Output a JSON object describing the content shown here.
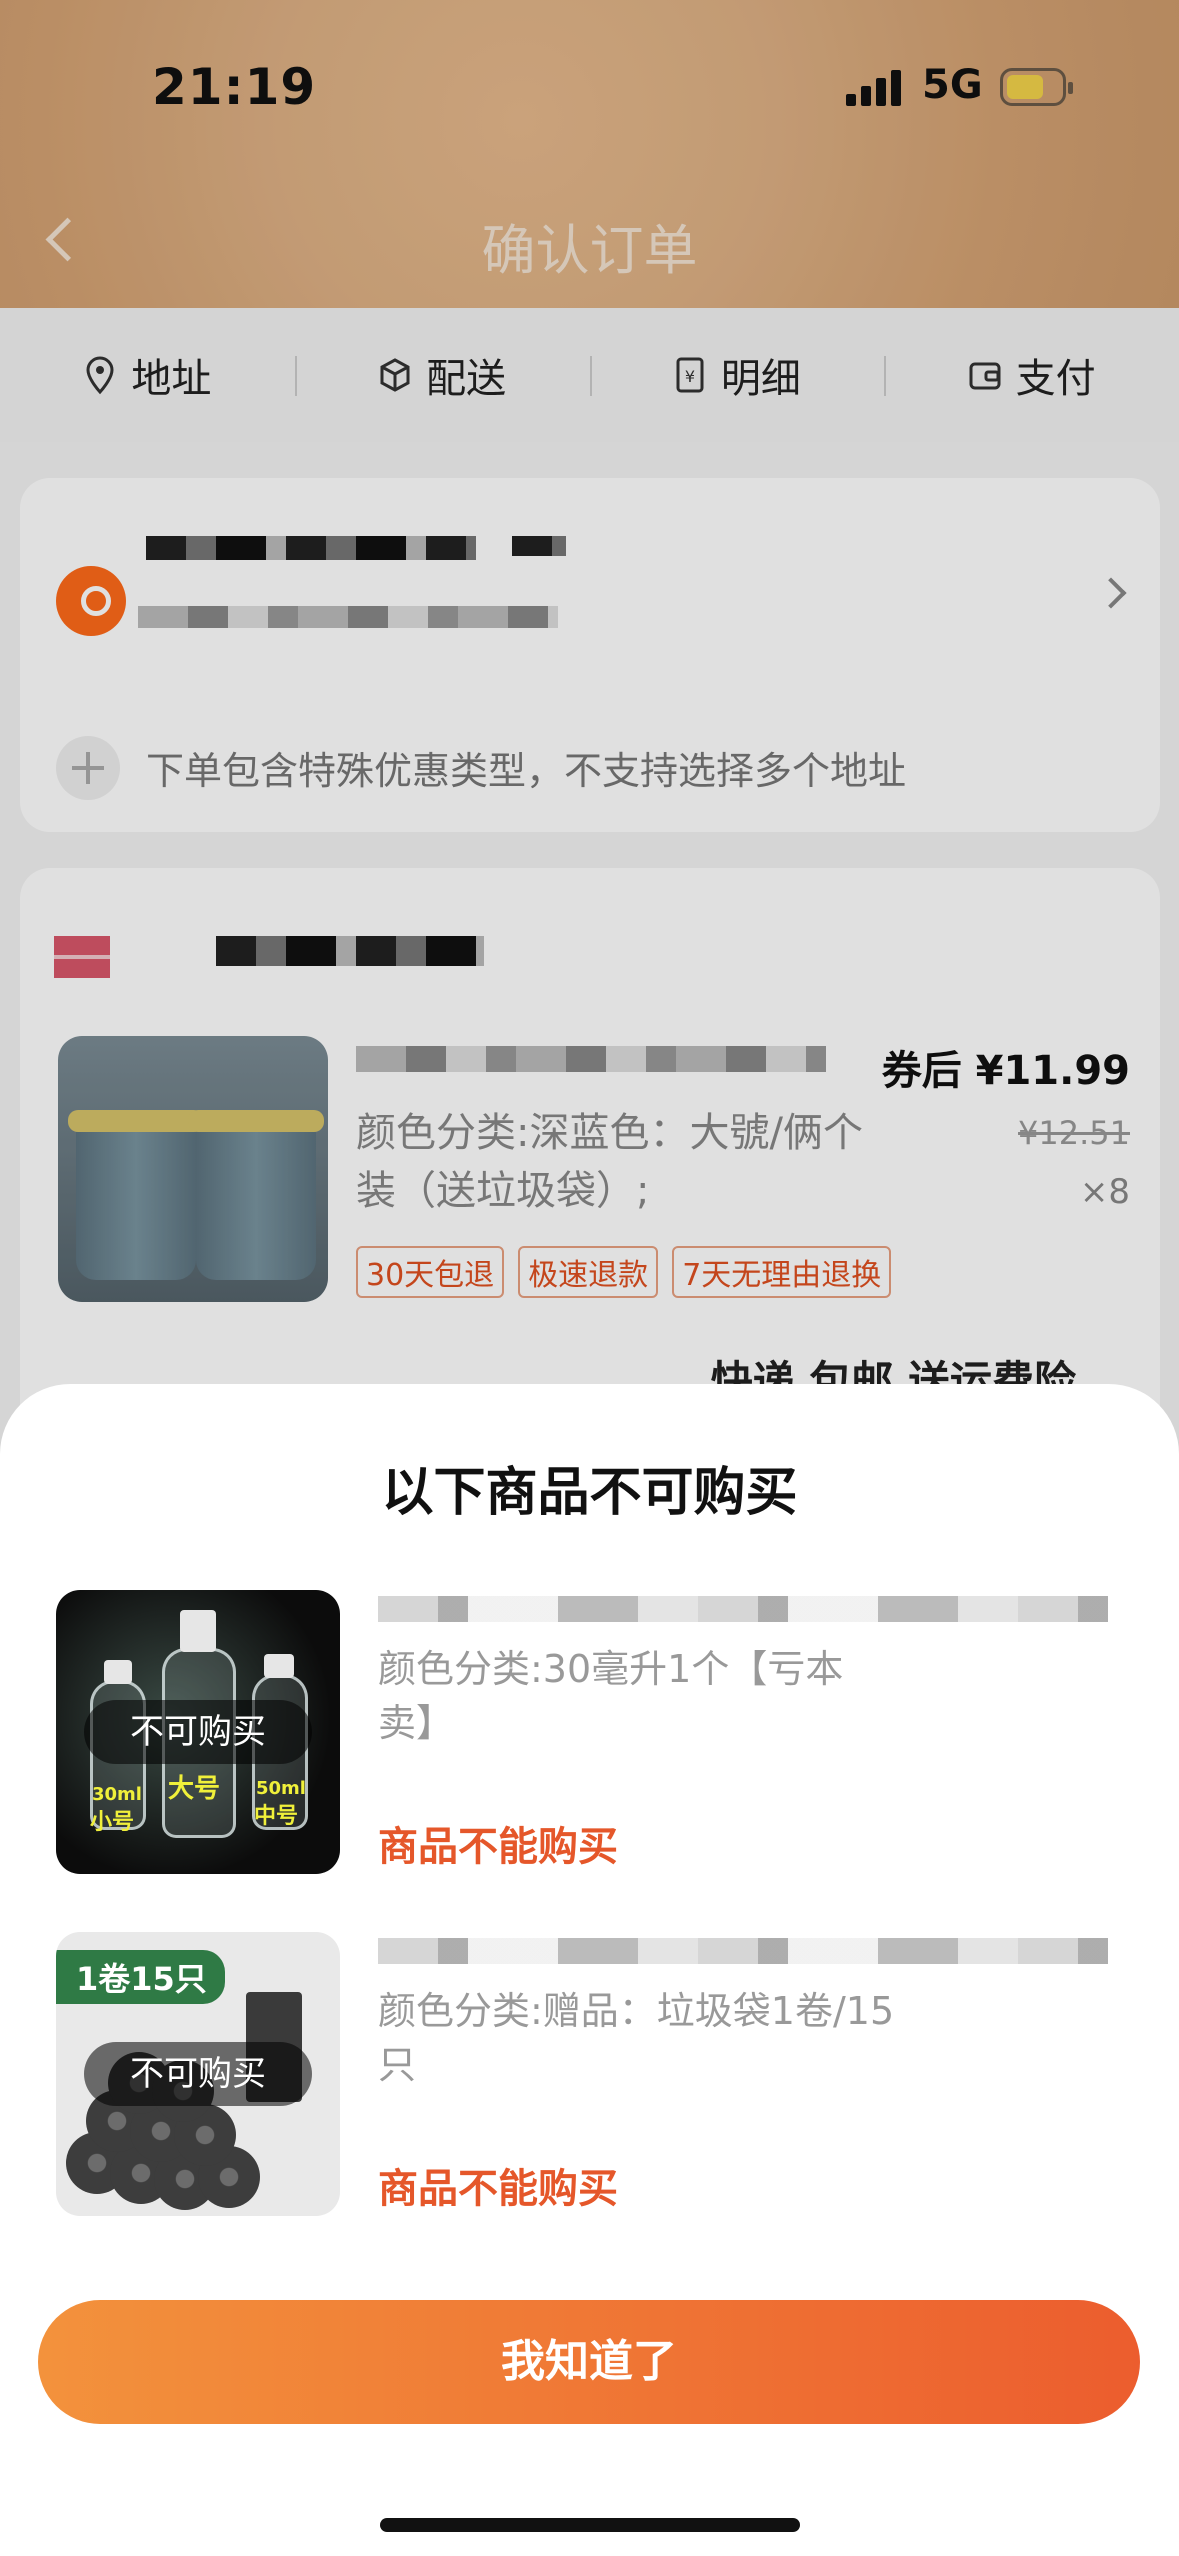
{
  "status_bar": {
    "time": "21:19",
    "network": "5G"
  },
  "header": {
    "title": "确认订单"
  },
  "steps": [
    {
      "label": "地址",
      "icon": "location-pin-icon"
    },
    {
      "label": "配送",
      "icon": "package-icon"
    },
    {
      "label": "明细",
      "icon": "receipt-icon"
    },
    {
      "label": "支付",
      "icon": "wallet-icon"
    }
  ],
  "address": {
    "note": "下单包含特殊优惠类型，不支持选择多个地址"
  },
  "order_item": {
    "price_label": "券后 ¥11.99",
    "spec": "颜色分类:深蓝色：大號/俩个装（送垃圾袋）;",
    "original_price": "¥12.51",
    "quantity": "×8",
    "tags": [
      "30天包退",
      "极速退款",
      "7天无理由退换"
    ],
    "shipping": "快递 包邮 送运费险"
  },
  "sheet": {
    "title": "以下商品不可购买",
    "items": [
      {
        "unavailable_label": "不可购买",
        "spec": "颜色分类:30毫升1个【亏本卖】",
        "status": "商品不能购买",
        "thumb_labels": [
          "30ml",
          "小号",
          "大号",
          "50ml",
          "中号"
        ]
      },
      {
        "badge": "1卷15只",
        "unavailable_label": "不可购买",
        "spec": "颜色分类:赠品：垃圾袋1卷/15只",
        "status": "商品不能购买"
      }
    ],
    "ok_button": "我知道了"
  },
  "colors": {
    "accent": "#ec5d2e",
    "status_red": "#e5572a",
    "header_bg": "#d4a273"
  }
}
